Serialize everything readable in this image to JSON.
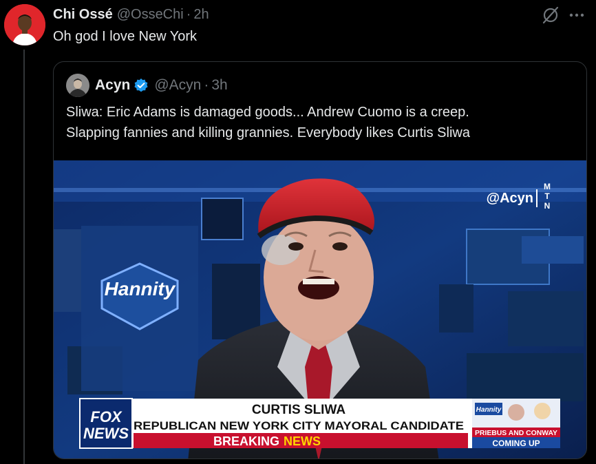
{
  "tweet": {
    "author_name": "Chi Ossé",
    "author_handle": "@OsseChi",
    "separator": "·",
    "time": "2h",
    "text": "Oh god I love New York"
  },
  "quote": {
    "author_name": "Acyn",
    "author_handle": "@Acyn",
    "separator": "·",
    "time": "3h",
    "text_line1": "Sliwa: Eric Adams is damaged goods... Andrew Cuomo is a creep.",
    "text_line2": "Slapping fannies and killing grannies. Everybody likes Curtis Sliwa"
  },
  "video": {
    "watermark": "@Acyn",
    "mtn_letters": [
      "M",
      "T",
      "N"
    ],
    "backdrop_logo": "Hannity",
    "network_line1": "FOX",
    "network_line2": "NEWS",
    "lower_third_name": "CURTIS SLIWA",
    "lower_third_title": "REPUBLICAN NEW YORK CITY MAYORAL CANDIDATE",
    "breaking_word1": "BREAKING",
    "breaking_word2": "NEWS",
    "promo_logo": "Hannity",
    "promo_line1": "PRIEBUS AND CONWAY",
    "promo_line2": "COMING UP"
  },
  "colors": {
    "accent_blue": "#1d9bf0",
    "background": "#000000",
    "muted_text": "#71767b",
    "beret_red": "#c8232b",
    "breaking_red": "#c8102e",
    "news_yellow": "#ffd400"
  },
  "icons": {
    "grok": "grok-icon",
    "more": "more-icon",
    "verified": "verified-badge-icon"
  }
}
